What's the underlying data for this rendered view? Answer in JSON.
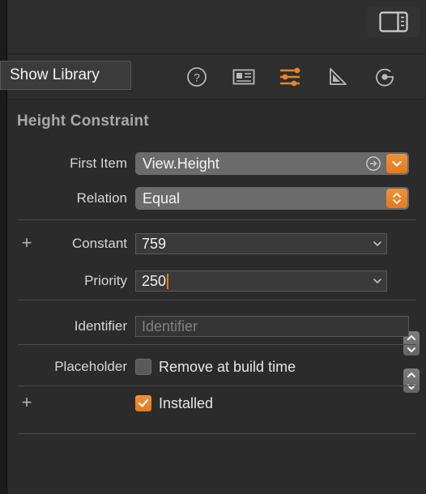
{
  "toolbar": {
    "inspector_toggle_label": "hide-or-show-the-inspectors"
  },
  "tooltip": {
    "text": "Show Library"
  },
  "inspector_tabs": [
    {
      "name": "quick-help-inspector",
      "icon": "question-circle-icon",
      "active": false
    },
    {
      "name": "identity-inspector",
      "icon": "identity-card-icon",
      "active": false
    },
    {
      "name": "attributes-inspector",
      "icon": "sliders-icon",
      "active": true
    },
    {
      "name": "size-inspector",
      "icon": "ruler-triangle-icon",
      "active": false
    },
    {
      "name": "connections-inspector",
      "icon": "arrow-circle-icon",
      "active": false
    }
  ],
  "panel": {
    "title": "Height Constraint",
    "rows": {
      "first_item": {
        "label": "First Item",
        "value": "View.Height"
      },
      "relation": {
        "label": "Relation",
        "value": "Equal"
      },
      "constant": {
        "label": "Constant",
        "value": "759"
      },
      "priority": {
        "label": "Priority",
        "value": "250"
      },
      "identifier": {
        "label": "Identifier",
        "placeholder": "Identifier",
        "value": ""
      },
      "placeholder": {
        "label": "Placeholder",
        "checkbox_label": "Remove at build time",
        "checked": false
      },
      "installed": {
        "label": "",
        "checkbox_label": "Installed",
        "checked": true
      }
    },
    "add_button_label": "+"
  },
  "colors": {
    "accent_orange": "#e07b22",
    "panel_background": "#2b2b2b",
    "toolbar_background": "#2e2e2e",
    "field_background": "#3a3a3a",
    "popup_background": "#6b6b6b",
    "label_text": "#d6d6d6",
    "title_text": "#a8a8a8"
  }
}
